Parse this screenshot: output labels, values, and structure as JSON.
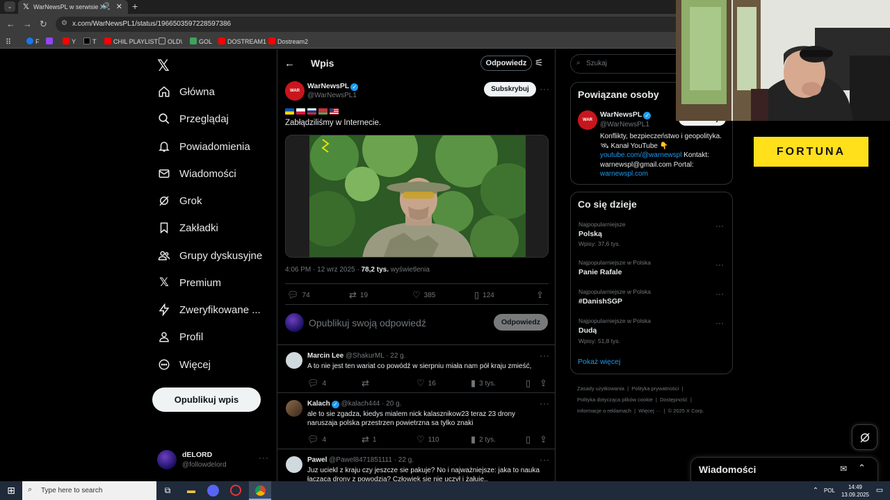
{
  "browser": {
    "tab_title": "WarNewsPL w serwisie X: „",
    "url": "x.com/WarNewsPL1/status/1966503597228597386",
    "bookmarks": [
      {
        "label": "F",
        "color": "#1877f2"
      },
      {
        "label": "",
        "color": "#9146ff"
      },
      {
        "label": "Y",
        "color": "#ff0000"
      },
      {
        "label": "T",
        "color": "#000000"
      },
      {
        "label": "CHIL PLAYLIST",
        "color": "#ff0000"
      },
      {
        "label": "OLD\\",
        "color": "#888888"
      },
      {
        "label": "GOL",
        "color": "#3fa35a"
      },
      {
        "label": "DOSTREAM1",
        "color": "#ff0000"
      },
      {
        "label": "Dostream2",
        "color": "#ff0000"
      }
    ]
  },
  "nav": {
    "items": [
      {
        "label": "Główna",
        "icon": "home-icon"
      },
      {
        "label": "Przeglądaj",
        "icon": "search-icon"
      },
      {
        "label": "Powiadomienia",
        "icon": "bell-icon"
      },
      {
        "label": "Wiadomości",
        "icon": "mail-icon"
      },
      {
        "label": "Grok",
        "icon": "grok-icon"
      },
      {
        "label": "Zakładki",
        "icon": "bookmark-icon"
      },
      {
        "label": "Grupy dyskusyjne",
        "icon": "people-icon"
      },
      {
        "label": "Premium",
        "icon": "x-icon"
      },
      {
        "label": "Zweryfikowane ...",
        "icon": "lightning-icon"
      },
      {
        "label": "Profil",
        "icon": "person-icon"
      },
      {
        "label": "Więcej",
        "icon": "more-circle-icon"
      }
    ],
    "post_button": "Opublikuj wpis",
    "user": {
      "name": "dELORD",
      "handle": "@followdelord"
    }
  },
  "post": {
    "header_title": "Wpis",
    "reply_button": "Odpowiedz",
    "author_name": "WarNewsPL",
    "author_handle": "@WarNewsPL1",
    "subscribe": "Subskrybuj",
    "text": "Zabłądziliśmy w Internecie.",
    "flags": [
      "#0057b7/#ffd700",
      "#ffffff/#dc143c",
      "#ffffff/#0039a6/#d52b1e",
      "#c8313e/#4aa657",
      "#b22234/#3c3b6e"
    ],
    "timestamp": "4:06 PM · 12 wrz 2025 · ",
    "views": "78,2 tys.",
    "views_label": " wyświetlenia",
    "stats": {
      "replies": "74",
      "reposts": "19",
      "likes": "385",
      "bookmarks": "124"
    },
    "compose_placeholder": "Opublikuj swoją odpowiedź",
    "compose_button": "Odpowiedz"
  },
  "replies": [
    {
      "name": "Marcin Lee",
      "handle": "@ShakurML · 22 g.",
      "text": "A to nie jest ten wariat co powódź w sierpniu miała nam pół kraju zmieść,",
      "replies": "4",
      "reposts": "",
      "likes": "16",
      "views": "3 tys."
    },
    {
      "name": "Kalach",
      "handle": "@kalach444 · 20 g.",
      "text": "ale to sie zgadza, kiedys mialem nick kalasznikow23 teraz 23 drony naruszaja polska przestrzen powietrzna sa tylko znaki",
      "replies": "4",
      "reposts": "1",
      "likes": "110",
      "views": "2 tys."
    },
    {
      "name": "Pawel",
      "handle": "@Pawel8471851111 · 22 g.",
      "text": "Juz uciekl z kraju czy jeszcze sie pakuje? No i najważniejsze: jaka to nauka łącząca drony z powodzia? Człowiek sie nie uczył i żałuję..",
      "replies": "",
      "reposts": "",
      "likes": "",
      "views": ""
    }
  ],
  "sidebar": {
    "search_placeholder": "Szukaj",
    "related_title": "Powiązane osoby",
    "related": {
      "name": "WarNewsPL",
      "handle": "@WarNewsPL1",
      "follow": "Obserwuj",
      "bio_1": "Konflikty, bezpieczeństwo i geopolityka. 🛰 Kanał YouTube 👇",
      "bio_link1": "youtube.com/@warnewspl",
      "bio_2": " Kontakt: warnewspl@gmail.com Portal: ",
      "bio_link2": "warnewspl.com"
    },
    "trends_title": "Co się dzieje",
    "trends": [
      {
        "meta": "Najpopularniejsze",
        "name": "Polską",
        "count": "Wpisy: 37,6 tys."
      },
      {
        "meta": "Najpopularniejsze w Polska",
        "name": "Panie Rafale",
        "count": ""
      },
      {
        "meta": "Najpopularniejsze w Polska",
        "name": "#DanishSGP",
        "count": ""
      },
      {
        "meta": "Najpopularniejsze w Polska",
        "name": "Dudą",
        "count": "Wpisy: 51,8 tys."
      }
    ],
    "show_more": "Pokaż więcej",
    "footer": [
      "Zasady użytkowania",
      "Polityka prywatności",
      "Polityka dotycząca plików cookie",
      "Dostępność",
      "Informacje o reklamach",
      "Więcej ···",
      "© 2025 X Corp."
    ]
  },
  "ad": {
    "brand": "FORTUNA"
  },
  "messages_drawer": {
    "title": "Wiadomości"
  },
  "taskbar": {
    "search_placeholder": "Type here to search",
    "lang": "POL",
    "time": "14:49",
    "date": "13.09.2025"
  },
  "colors": {
    "accent": "#1d9bf0",
    "background": "#000000",
    "border": "#2f3336",
    "muted": "#71767b"
  }
}
